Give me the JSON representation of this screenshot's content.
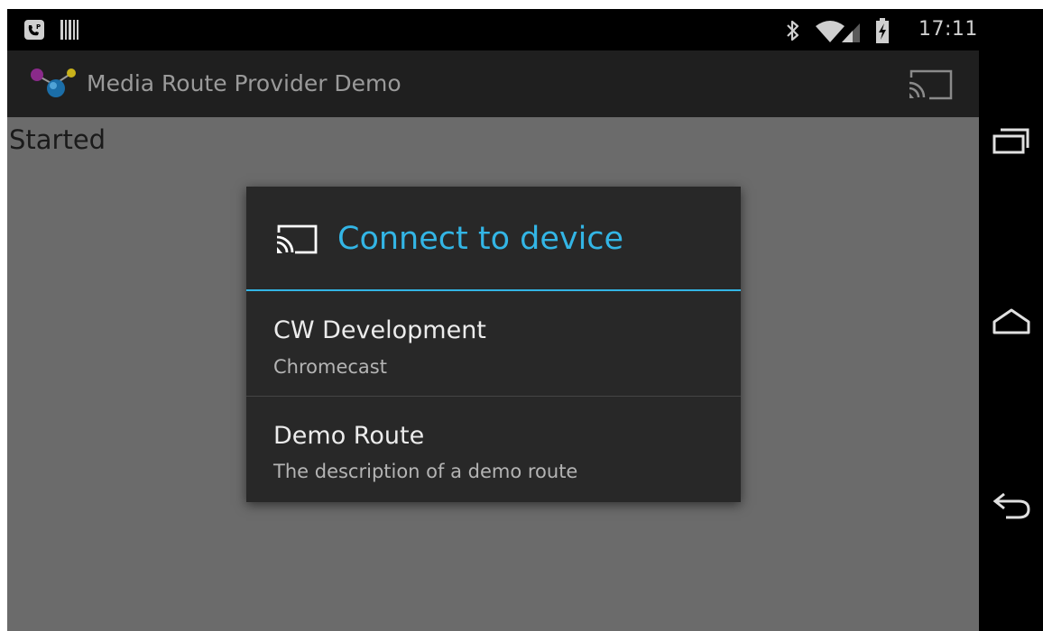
{
  "status_bar": {
    "time": "17:11",
    "left_icons": [
      "voicemail-icon",
      "barcode-icon"
    ],
    "right_icons": [
      "bluetooth-icon",
      "wifi-icon",
      "signal-icon",
      "battery-charging-icon"
    ]
  },
  "action_bar": {
    "title": "Media Route Provider Demo",
    "app_icon": "app-logo-icon",
    "cast_icon": "cast-icon"
  },
  "content": {
    "status_text": "Started"
  },
  "dialog": {
    "icon": "cast-icon",
    "title": "Connect to device",
    "routes": [
      {
        "name": "CW Development",
        "description": "Chromecast"
      },
      {
        "name": "Demo Route",
        "description": "The description of a demo route"
      }
    ]
  },
  "nav_bar": {
    "buttons": [
      "recent-apps-icon",
      "home-icon",
      "back-icon"
    ]
  },
  "colors": {
    "accent": "#33b5e5",
    "dialog_bg": "#282828",
    "scrim": "#6b6b6b"
  }
}
